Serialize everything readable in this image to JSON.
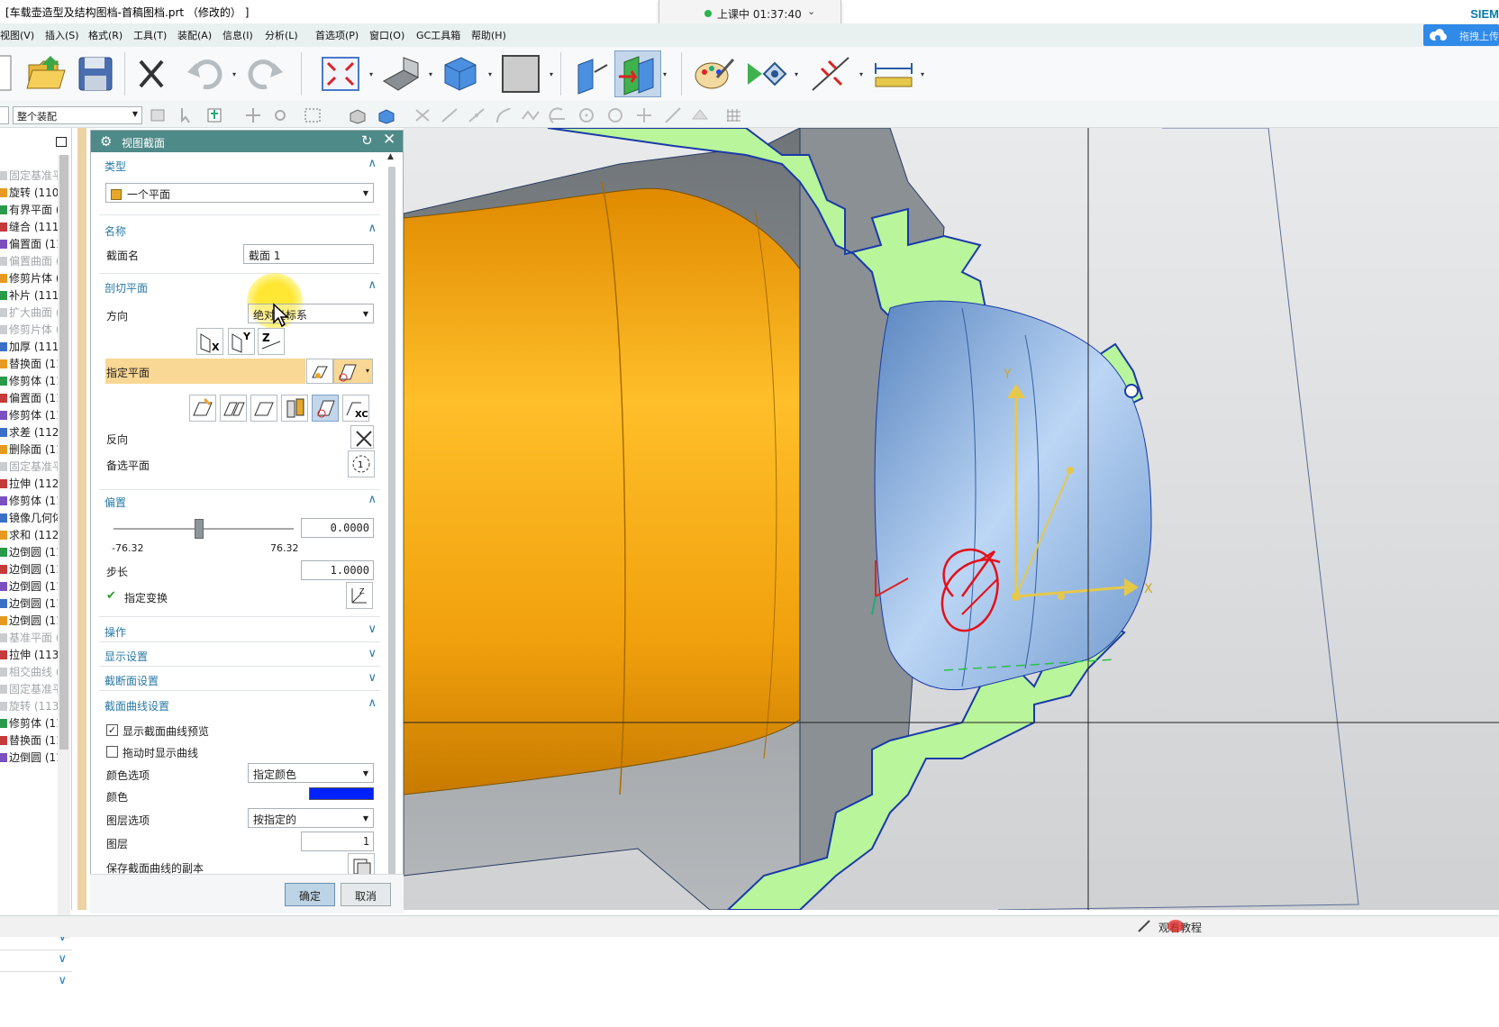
{
  "window": {
    "title": "[车载壶造型及结构图档-首稿图档.prt （修改的） ]",
    "brand": "SIEM"
  },
  "timer": {
    "label": "上课中 01:37:40"
  },
  "menu": {
    "items": [
      "视图(V)",
      "插入(S)",
      "格式(R)",
      "工具(T)",
      "装配(A)",
      "信息(I)",
      "分析(L)",
      "首选项(P)",
      "窗口(O)",
      "GC工具箱",
      "帮助(H)"
    ]
  },
  "cloud_button": {
    "label": "拖拽上传"
  },
  "selection_filter": {
    "value": "整个装配"
  },
  "nav_tree": {
    "items": [
      {
        "label": "固定基准平",
        "dim": true
      },
      {
        "label": "旋转 (110",
        "dim": false
      },
      {
        "label": "有界平面 (",
        "dim": false
      },
      {
        "label": "缝合 (111",
        "dim": false
      },
      {
        "label": "偏置面 (11",
        "dim": false
      },
      {
        "label": "偏置曲面 (",
        "dim": true
      },
      {
        "label": "修剪片体 (",
        "dim": false
      },
      {
        "label": "补片 (111",
        "dim": false
      },
      {
        "label": "扩大曲面 (",
        "dim": true
      },
      {
        "label": "修剪片体 (",
        "dim": true
      },
      {
        "label": "加厚 (111",
        "dim": false
      },
      {
        "label": "替换面 (11",
        "dim": false
      },
      {
        "label": "修剪体 (11",
        "dim": false
      },
      {
        "label": "偏置面 (11",
        "dim": false
      },
      {
        "label": "修剪体 (11",
        "dim": false
      },
      {
        "label": "求差 (112",
        "dim": false
      },
      {
        "label": "删除面 (11",
        "dim": false
      },
      {
        "label": "固定基准平",
        "dim": true
      },
      {
        "label": "拉伸 (112",
        "dim": false
      },
      {
        "label": "修剪体 (11",
        "dim": false
      },
      {
        "label": "镜像几何体",
        "dim": false
      },
      {
        "label": "求和 (112",
        "dim": false
      },
      {
        "label": "边倒圆 (11",
        "dim": false
      },
      {
        "label": "边倒圆 (11",
        "dim": false
      },
      {
        "label": "边倒圆 (11",
        "dim": false
      },
      {
        "label": "边倒圆 (11",
        "dim": false
      },
      {
        "label": "边倒圆 (11",
        "dim": false
      },
      {
        "label": "基准平面 (",
        "dim": true
      },
      {
        "label": "拉伸 (113",
        "dim": false
      },
      {
        "label": "相交曲线 (",
        "dim": true
      },
      {
        "label": "固定基准平",
        "dim": true
      },
      {
        "label": "旋转 (113",
        "dim": true
      },
      {
        "label": "修剪体 (11",
        "dim": false
      },
      {
        "label": "替换面 (11",
        "dim": false
      },
      {
        "label": "边倒圆 (11",
        "dim": false
      }
    ]
  },
  "dialog": {
    "title": "视图截面",
    "sections": {
      "type": {
        "header": "类型",
        "value": "一个平面"
      },
      "name": {
        "header": "名称",
        "label": "截面名",
        "value": "截面 1"
      },
      "cut_plane": {
        "header": "剖切平面",
        "direction_label": "方向",
        "direction_value": "绝对坐标系",
        "specify_plane": "指定平面",
        "reverse": "反向",
        "alt_plane": "备选平面"
      },
      "offset": {
        "header": "偏置",
        "value": "0.0000",
        "min": "-76.32",
        "max": "76.32",
        "step_label": "步长",
        "step_value": "1.0000",
        "transform_label": "指定变换"
      },
      "operation": {
        "header": "操作"
      },
      "display": {
        "header": "显示设置"
      },
      "section_face": {
        "header": "截断面设置"
      },
      "section_curve": {
        "header": "截面曲线设置",
        "show_preview": "显示截面曲线预览",
        "show_preview_checked": true,
        "drag_show": "拖动时显示曲线",
        "drag_show_checked": false,
        "color_option_label": "颜色选项",
        "color_option_value": "指定颜色",
        "color_label": "颜色",
        "color": "#0022ff",
        "layer_option_label": "图层选项",
        "layer_option_value": "按指定的",
        "layer_label": "图层",
        "layer_value": "1",
        "save_copy": "保存截面曲线的副本"
      }
    },
    "ok": "确定",
    "cancel": "取消"
  },
  "viewport": {
    "axis_labels": {
      "x": "X",
      "y": "Y"
    }
  },
  "statusbar": {
    "text": "观看教程"
  },
  "colors": {
    "dialog_header": "#4e8a88",
    "section_header": "#2a7aa6",
    "cut_fill": "#b9f59a",
    "body_orange": "#f0a60f",
    "body_blue": "#8fb8e8"
  }
}
